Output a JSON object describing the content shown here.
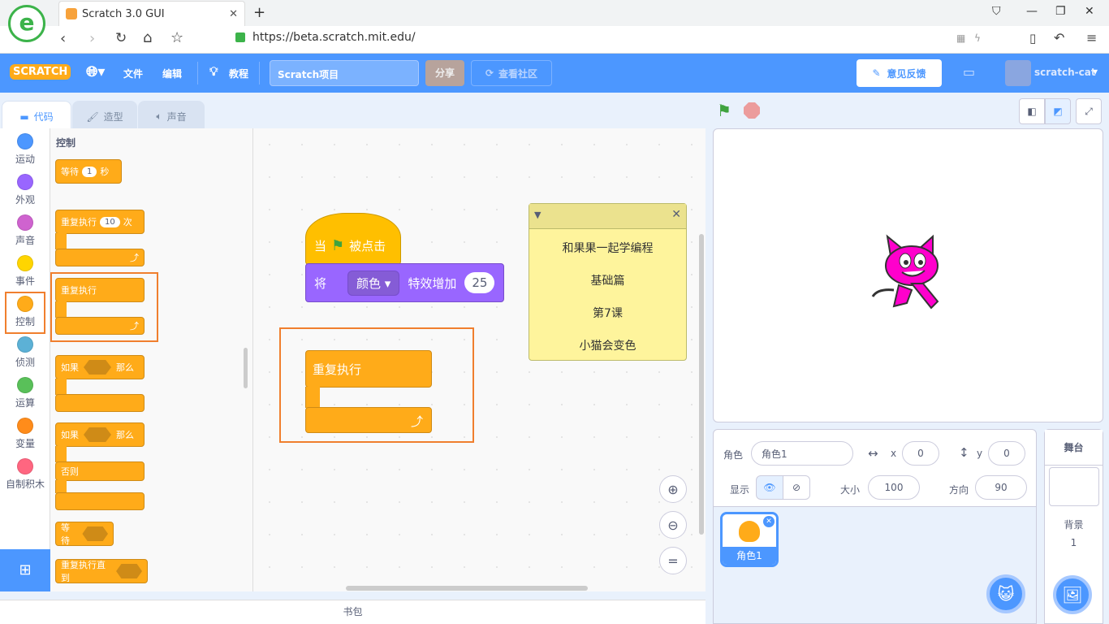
{
  "browser": {
    "tab_title": "Scratch 3.0 GUI",
    "url": "https://beta.scratch.mit.edu/"
  },
  "menubar": {
    "logo": "SCRATCH",
    "file": "文件",
    "edit": "编辑",
    "tutorials": "教程",
    "project_title": "Scratch项目",
    "share": "分享",
    "see_community": "查看社区",
    "feedback": "意见反馈",
    "username": "scratch-cat"
  },
  "tabs": {
    "code": "代码",
    "costumes": "造型",
    "sounds": "声音"
  },
  "categories": [
    {
      "label": "运动",
      "color": "#4c97ff"
    },
    {
      "label": "外观",
      "color": "#9966ff"
    },
    {
      "label": "声音",
      "color": "#cf63cf"
    },
    {
      "label": "事件",
      "color": "#ffd500"
    },
    {
      "label": "控制",
      "color": "#ffab19"
    },
    {
      "label": "侦测",
      "color": "#5cb1d6"
    },
    {
      "label": "运算",
      "color": "#59c059"
    },
    {
      "label": "变量",
      "color": "#ff8c1a"
    },
    {
      "label": "自制积木",
      "color": "#ff6680"
    }
  ],
  "palette": {
    "heading": "控制",
    "wait": "等待",
    "wait_val": "1",
    "wait_unit": "秒",
    "repeat": "重复执行",
    "repeat_val": "10",
    "repeat_unit": "次",
    "forever": "重复执行",
    "if": "如果",
    "then": "那么",
    "else": "否则",
    "wait_until": "等待",
    "repeat_until": "重复执行直到"
  },
  "script": {
    "when": "当",
    "clicked": "被点击",
    "set": "将",
    "effect": "颜色",
    "change": "特效增加",
    "amount": "25",
    "forever": "重复执行"
  },
  "note": {
    "lines": [
      "和果果一起学编程",
      "基础篇",
      "第7课",
      "小猫会变色"
    ]
  },
  "backpack": "书包",
  "sprite": {
    "label": "角色",
    "name": "角色1",
    "x_label": "x",
    "x": "0",
    "y_label": "y",
    "y": "0",
    "show": "显示",
    "size_label": "大小",
    "size": "100",
    "dir_label": "方向",
    "dir": "90",
    "thumb_label": "角色1"
  },
  "stage_panel": {
    "title": "舞台",
    "backdrops": "背景",
    "count": "1"
  }
}
